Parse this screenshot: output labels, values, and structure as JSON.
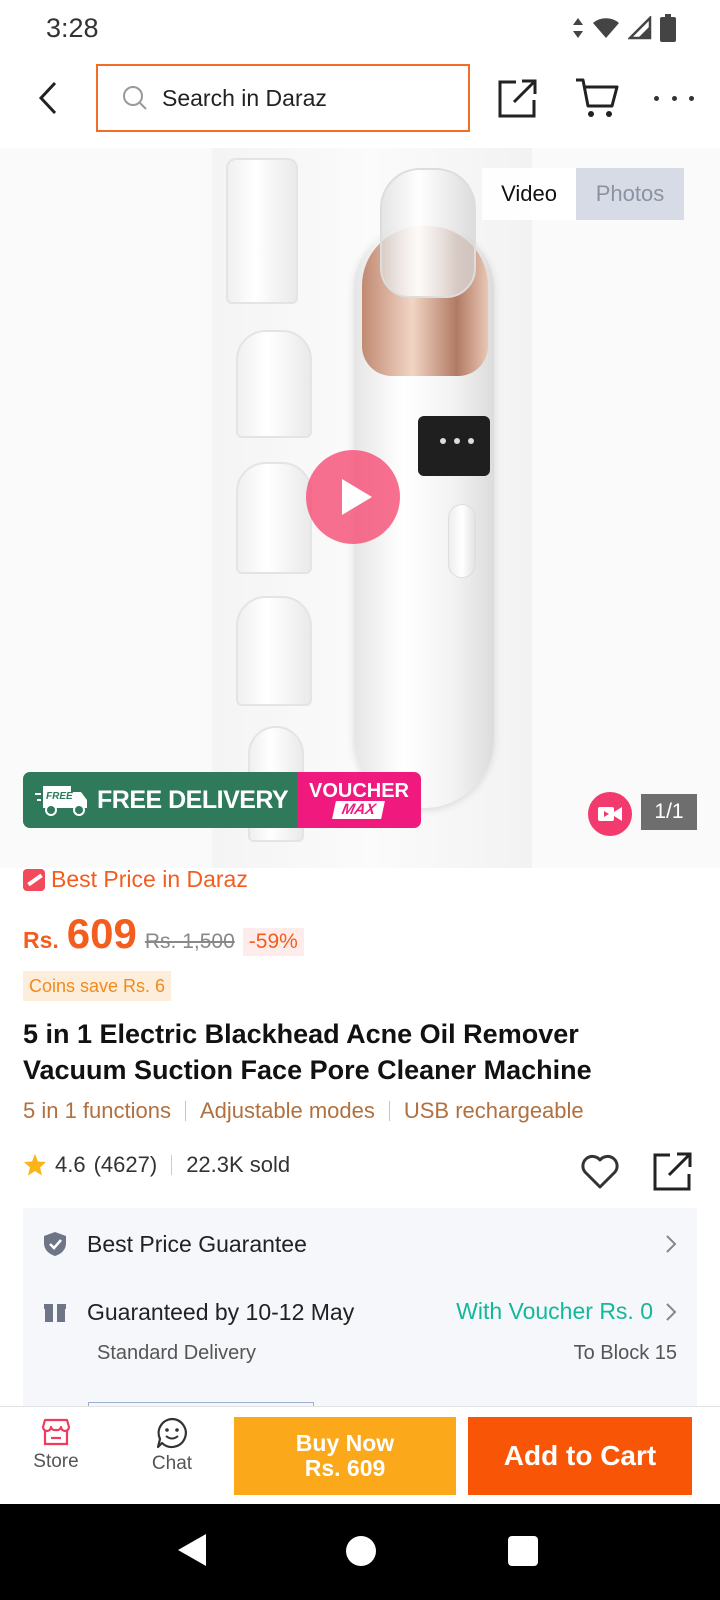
{
  "status_bar": {
    "time": "3:28"
  },
  "search": {
    "placeholder": "Search in Daraz"
  },
  "gallery": {
    "tab_video": "Video",
    "tab_photos": "Photos",
    "counter": "1/1",
    "promo_free": "FREE DELIVERY",
    "promo_free_tag": "FREE",
    "promo_voucher": "VOUCHER",
    "promo_max": "MAX"
  },
  "product": {
    "best_price_label": "Best Price in Daraz",
    "currency": "Rs.",
    "price": "609",
    "original_price": "Rs. 1,500",
    "discount": "-59%",
    "coins": "Coins save Rs. 6",
    "title": "5 in 1 Electric Blackhead Acne Oil Remover Vacuum Suction Face Pore Cleaner Machine",
    "features": [
      "5 in 1 functions",
      "Adjustable modes",
      "USB rechargeable"
    ],
    "rating": "4.6",
    "rating_count": "(4627)",
    "sold": "22.3K sold"
  },
  "info_card": {
    "guarantee": "Best Price Guarantee",
    "delivery": "Guaranteed by 10-12 May",
    "voucher": "With Voucher Rs. 0",
    "delivery_type": "Standard Delivery",
    "location": "To Block 15"
  },
  "bottom_bar": {
    "store": "Store",
    "chat": "Chat",
    "buy_now_line1": "Buy Now",
    "buy_now_line2": "Rs. 609",
    "add_to_cart": "Add to Cart"
  },
  "colors": {
    "brand_orange": "#f85606",
    "buy_now_yellow": "#fba81b",
    "voucher_green": "#13b89a",
    "promo_green": "#2f7a5a",
    "promo_pink": "#f0197d"
  }
}
